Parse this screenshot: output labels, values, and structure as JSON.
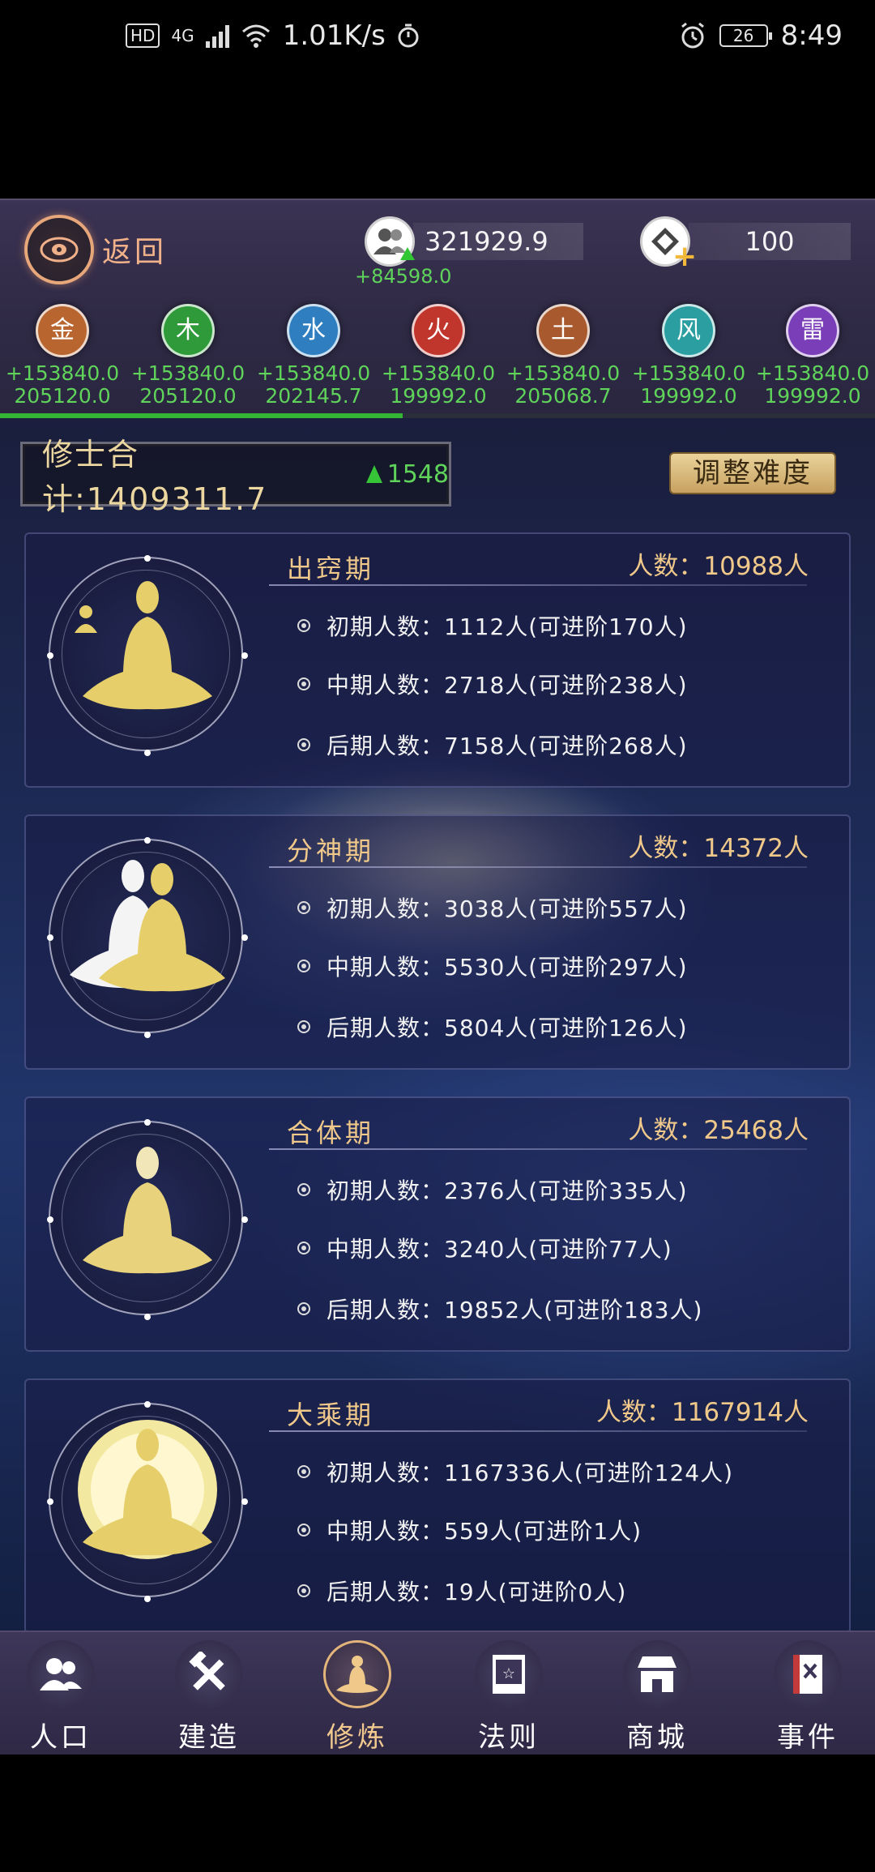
{
  "status_bar": {
    "hd": "HD",
    "network": "4G",
    "speed": "1.01K/s",
    "battery": "26",
    "time": "8:49"
  },
  "header": {
    "back_label": "返回",
    "population": "321929.9",
    "population_delta": "+84598.0",
    "gems": "100"
  },
  "elements": [
    {
      "name": "金",
      "rate": "+153840.0",
      "total": "205120.0",
      "color": "#b8652f"
    },
    {
      "name": "木",
      "rate": "+153840.0",
      "total": "205120.0",
      "color": "#2f9a3a"
    },
    {
      "name": "水",
      "rate": "+153840.0",
      "total": "202145.7",
      "color": "#2f7fc0"
    },
    {
      "name": "火",
      "rate": "+153840.0",
      "total": "199992.0",
      "color": "#c0352c"
    },
    {
      "name": "土",
      "rate": "+153840.0",
      "total": "205068.7",
      "color": "#a85a2e"
    },
    {
      "name": "风",
      "rate": "+153840.0",
      "total": "199992.0",
      "color": "#2a9ea0"
    },
    {
      "name": "雷",
      "rate": "+153840.0",
      "total": "199992.0",
      "color": "#7a3fb8"
    }
  ],
  "progress": 0.46,
  "summary": {
    "label": "修士合计:1409311.7",
    "delta": "1548",
    "adjust_button": "调整难度"
  },
  "realms": [
    {
      "name": "出窍期",
      "count": "人数：10988人",
      "stages": [
        "初期人数：1112人(可进阶170人)",
        "中期人数：2718人(可进阶238人)",
        "后期人数：7158人(可进阶268人)"
      ]
    },
    {
      "name": "分神期",
      "count": "人数：14372人",
      "stages": [
        "初期人数：3038人(可进阶557人)",
        "中期人数：5530人(可进阶297人)",
        "后期人数：5804人(可进阶126人)"
      ]
    },
    {
      "name": "合体期",
      "count": "人数：25468人",
      "stages": [
        "初期人数：2376人(可进阶335人)",
        "中期人数：3240人(可进阶77人)",
        "后期人数：19852人(可进阶183人)"
      ]
    },
    {
      "name": "大乘期",
      "count": "人数：1167914人",
      "stages": [
        "初期人数：1167336人(可进阶124人)",
        "中期人数：559人(可进阶1人)",
        "后期人数：19人(可进阶0人)"
      ]
    }
  ],
  "nav": [
    {
      "label": "人口",
      "icon": "people-icon"
    },
    {
      "label": "建造",
      "icon": "hammer-wrench-icon"
    },
    {
      "label": "修炼",
      "icon": "meditation-icon"
    },
    {
      "label": "法则",
      "icon": "scroll-icon"
    },
    {
      "label": "商城",
      "icon": "shop-icon"
    },
    {
      "label": "事件",
      "icon": "book-icon"
    }
  ],
  "active_nav": "修炼"
}
